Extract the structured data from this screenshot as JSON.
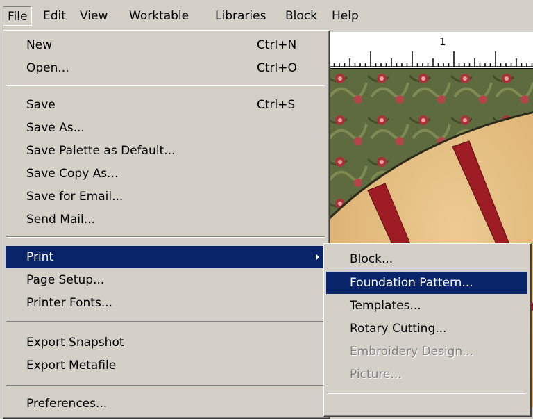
{
  "menubar": {
    "items": [
      "File",
      "Edit",
      "View",
      "Worktable",
      "Libraries",
      "Block",
      "Help"
    ]
  },
  "ruler": {
    "label": "1"
  },
  "file_menu": {
    "items": [
      {
        "label": "New",
        "shortcut": "Ctrl+N"
      },
      {
        "label": "Open...",
        "shortcut": "Ctrl+O"
      },
      {
        "label": "Save",
        "shortcut": "Ctrl+S"
      },
      {
        "label": "Save As..."
      },
      {
        "label": "Save Palette as Default..."
      },
      {
        "label": "Save Copy As..."
      },
      {
        "label": "Save for Email..."
      },
      {
        "label": "Send Mail..."
      },
      {
        "label": "Print",
        "highlighted": true,
        "has_submenu": true
      },
      {
        "label": "Page Setup..."
      },
      {
        "label": "Printer Fonts..."
      },
      {
        "label": "Export Snapshot"
      },
      {
        "label": "Export Metafile"
      },
      {
        "label": "Preferences..."
      }
    ]
  },
  "print_submenu": {
    "items": [
      {
        "label": "Block..."
      },
      {
        "label": "Foundation Pattern...",
        "highlighted": true
      },
      {
        "label": "Templates..."
      },
      {
        "label": "Rotary Cutting..."
      },
      {
        "label": "Embroidery Design...",
        "disabled": true
      },
      {
        "label": "Picture...",
        "disabled": true
      }
    ]
  },
  "colors": {
    "menu_bg": "#d4d0c8",
    "highlight": "#0a246a",
    "disabled_text": "#808080",
    "quilt_green": "#5e6b3e",
    "quilt_tan": "#e0b77a",
    "quilt_red": "#9e1c24"
  }
}
